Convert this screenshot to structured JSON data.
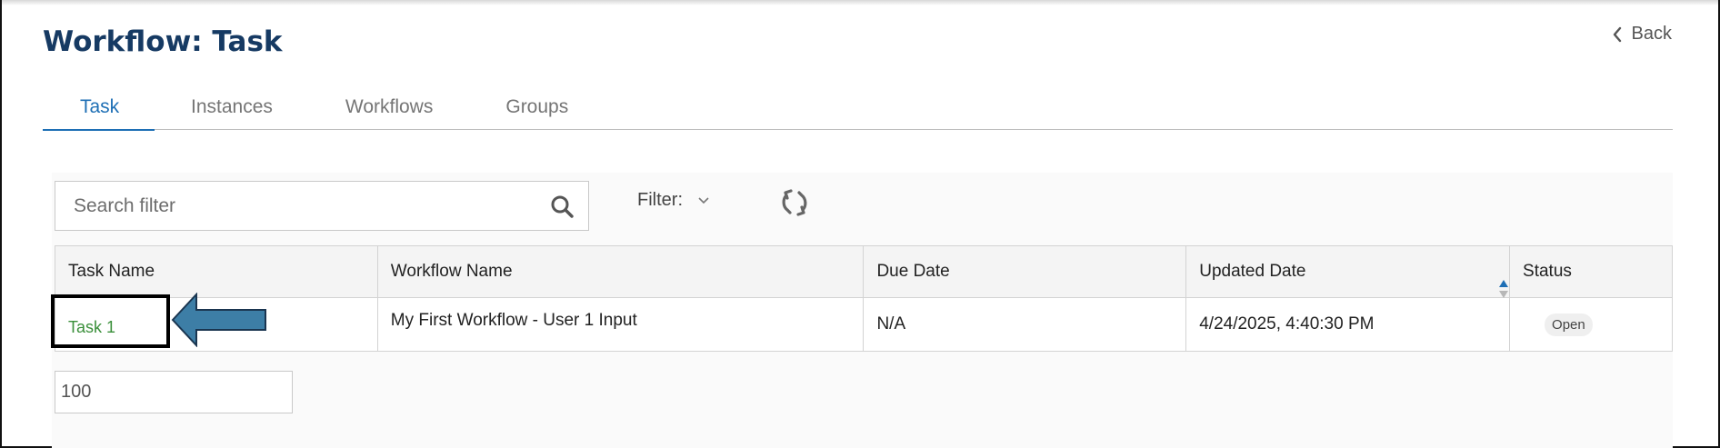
{
  "header": {
    "title": "Workflow: Task",
    "back_label": "Back"
  },
  "tabs": [
    {
      "label": "Task",
      "active": true
    },
    {
      "label": "Instances",
      "active": false
    },
    {
      "label": "Workflows",
      "active": false
    },
    {
      "label": "Groups",
      "active": false
    }
  ],
  "toolbar": {
    "search_placeholder": "Search filter",
    "filter_label": "Filter:"
  },
  "table": {
    "columns": [
      "Task Name",
      "Workflow Name",
      "Due Date",
      "Updated Date",
      "Status"
    ],
    "rows": [
      {
        "task_name": "Task 1",
        "workflow_name": "My First Workflow - User 1 Input",
        "due_date": "N/A",
        "updated_date": "4/24/2025, 4:40:30 PM",
        "status": "Open"
      }
    ]
  },
  "pagination": {
    "page_size": "100"
  },
  "colors": {
    "title": "#163a63",
    "active_tab": "#1e6fb5",
    "task_link": "#3a8f3a",
    "annotation_arrow": "#3d7ea6"
  },
  "icons": {
    "back": "chevron-left-icon",
    "search": "search-icon",
    "filter": "chevron-down-icon",
    "refresh": "refresh-icon",
    "sort": "sort-arrows-icon"
  }
}
